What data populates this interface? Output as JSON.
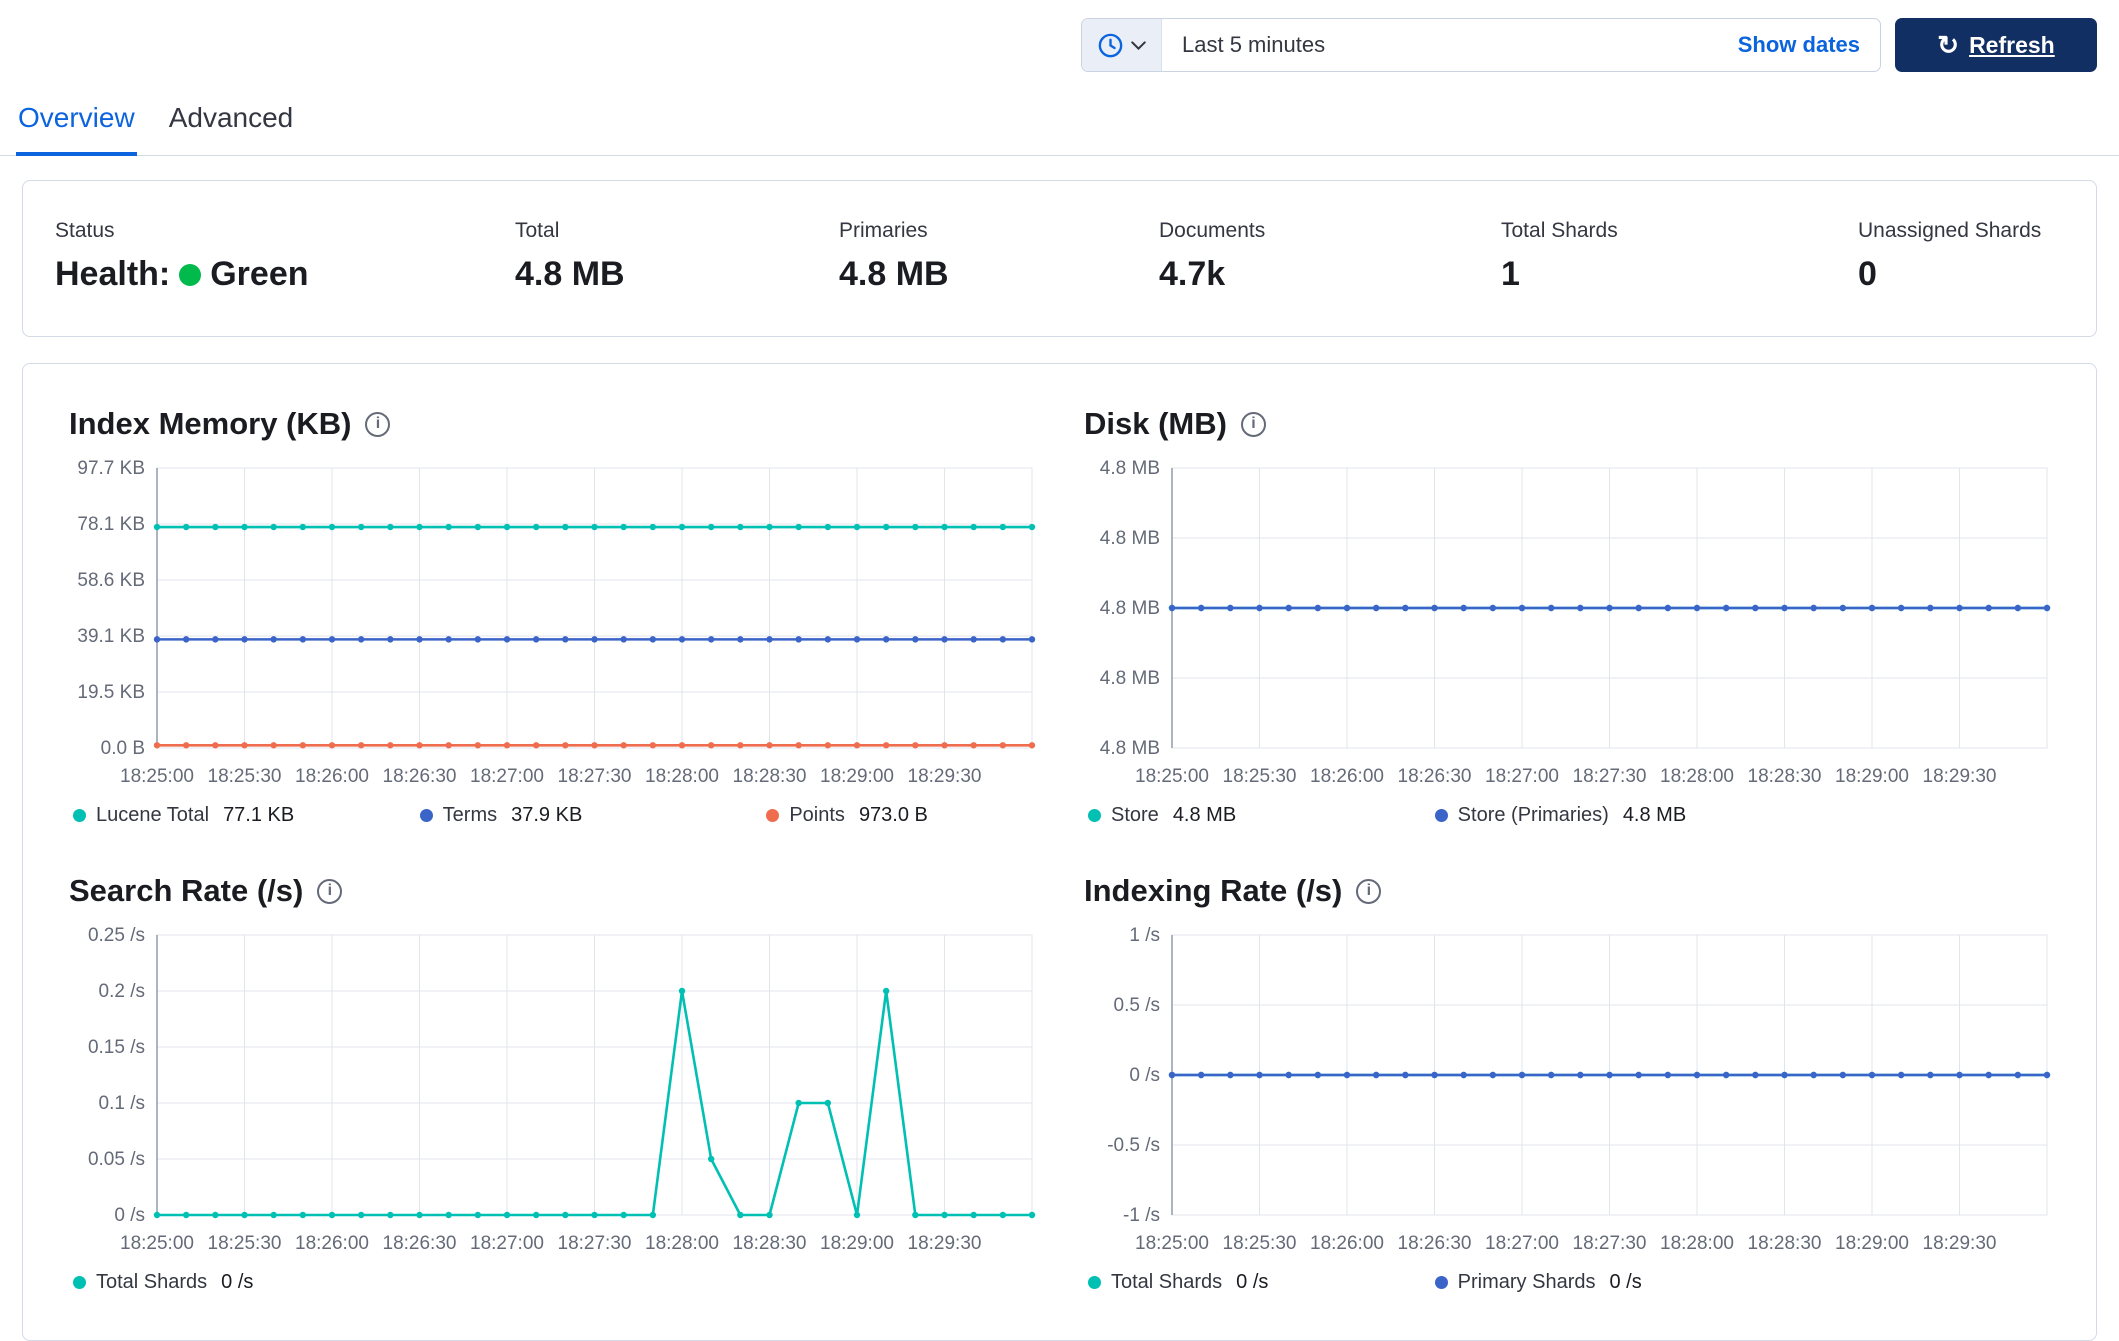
{
  "time_bar": {
    "selected_range": "Last 5 minutes",
    "show_dates_label": "Show dates",
    "refresh_label": "Refresh"
  },
  "tabs": [
    {
      "label": "Overview",
      "active": true
    },
    {
      "label": "Advanced",
      "active": false
    }
  ],
  "stats": [
    {
      "label": "Status",
      "value_prefix": "Health:",
      "value": "Green"
    },
    {
      "label": "Total",
      "value": "4.8 MB"
    },
    {
      "label": "Primaries",
      "value": "4.8 MB"
    },
    {
      "label": "Documents",
      "value": "4.7k"
    },
    {
      "label": "Total Shards",
      "value": "1"
    },
    {
      "label": "Unassigned Shards",
      "value": "0"
    }
  ],
  "colors": {
    "teal": "#00BFB3",
    "blue": "#3B64C8",
    "orange": "#EF6C4E",
    "health_green": "#00BB4B",
    "accent_blue": "#0B64DD",
    "refresh_navy": "#122F63",
    "grid": "#E0E5EC",
    "axis": "#98A1B2",
    "axis_text": "#646A77"
  },
  "chart_data": [
    {
      "type": "line",
      "title": "Index Memory (KB)",
      "x_ticks": [
        "18:25:00",
        "18:25:30",
        "18:26:00",
        "18:26:30",
        "18:27:00",
        "18:27:30",
        "18:28:00",
        "18:28:30",
        "18:29:00",
        "18:29:30"
      ],
      "y_ticks": [
        "0.0 B",
        "19.5 KB",
        "39.1 KB",
        "58.6 KB",
        "78.1 KB",
        "97.7 KB"
      ],
      "y_domain": [
        0,
        97.7
      ],
      "n_points": 31,
      "legend_position": "bottom",
      "grid": true,
      "series": [
        {
          "name": "Lucene Total",
          "legend_value": "77.1 KB",
          "color": "teal",
          "constant": 77.1
        },
        {
          "name": "Terms",
          "legend_value": "37.9 KB",
          "color": "blue",
          "constant": 37.9
        },
        {
          "name": "Points",
          "legend_value": "973.0 B",
          "color": "orange",
          "constant": 0.95
        }
      ]
    },
    {
      "type": "line",
      "title": "Disk (MB)",
      "x_ticks": [
        "18:25:00",
        "18:25:30",
        "18:26:00",
        "18:26:30",
        "18:27:00",
        "18:27:30",
        "18:28:00",
        "18:28:30",
        "18:29:00",
        "18:29:30"
      ],
      "y_ticks": [
        "4.8 MB",
        "4.8 MB",
        "4.8 MB",
        "4.8 MB",
        "4.8 MB"
      ],
      "y_domain": [
        4.75,
        4.85
      ],
      "n_points": 31,
      "legend_position": "bottom",
      "grid": true,
      "series": [
        {
          "name": "Store",
          "legend_value": "4.8 MB",
          "color": "teal",
          "constant": 4.8
        },
        {
          "name": "Store (Primaries)",
          "legend_value": "4.8 MB",
          "color": "blue",
          "constant": 4.8
        }
      ]
    },
    {
      "type": "line",
      "title": "Search Rate (/s)",
      "x_ticks": [
        "18:25:00",
        "18:25:30",
        "18:26:00",
        "18:26:30",
        "18:27:00",
        "18:27:30",
        "18:28:00",
        "18:28:30",
        "18:29:00",
        "18:29:30"
      ],
      "y_ticks": [
        "0 /s",
        "0.05 /s",
        "0.1 /s",
        "0.15 /s",
        "0.2 /s",
        "0.25 /s"
      ],
      "y_domain": [
        0,
        0.25
      ],
      "n_points": 31,
      "legend_position": "bottom",
      "grid": true,
      "series": [
        {
          "name": "Total Shards",
          "legend_value": "0 /s",
          "color": "teal",
          "values": [
            0,
            0,
            0,
            0,
            0,
            0,
            0,
            0,
            0,
            0,
            0,
            0,
            0,
            0,
            0,
            0,
            0,
            0,
            0.2,
            0.05,
            0,
            0,
            0.1,
            0.1,
            0,
            0.2,
            0,
            0,
            0,
            0,
            0
          ]
        }
      ]
    },
    {
      "type": "line",
      "title": "Indexing Rate (/s)",
      "x_ticks": [
        "18:25:00",
        "18:25:30",
        "18:26:00",
        "18:26:30",
        "18:27:00",
        "18:27:30",
        "18:28:00",
        "18:28:30",
        "18:29:00",
        "18:29:30"
      ],
      "y_ticks": [
        "-1 /s",
        "-0.5 /s",
        "0 /s",
        "0.5 /s",
        "1 /s"
      ],
      "y_domain": [
        -1,
        1
      ],
      "n_points": 31,
      "legend_position": "bottom",
      "grid": true,
      "series": [
        {
          "name": "Total Shards",
          "legend_value": "0 /s",
          "color": "teal",
          "constant": 0
        },
        {
          "name": "Primary Shards",
          "legend_value": "0 /s",
          "color": "blue",
          "constant": 0
        }
      ]
    }
  ]
}
